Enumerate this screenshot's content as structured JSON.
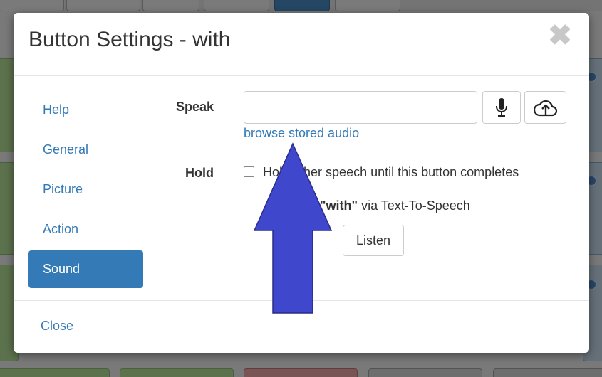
{
  "background": {
    "toolbar_tabs": [
      "",
      "",
      "",
      "",
      "",
      ""
    ]
  },
  "modal": {
    "title": "Button Settings - with",
    "close_glyph": "✖",
    "nav": [
      {
        "label": "Help",
        "active": false
      },
      {
        "label": "General",
        "active": false
      },
      {
        "label": "Picture",
        "active": false
      },
      {
        "label": "Action",
        "active": false
      },
      {
        "label": "Sound",
        "active": true
      }
    ],
    "speak": {
      "label": "Speak",
      "value": "",
      "placeholder": "",
      "record_icon": "microphone-icon",
      "upload_icon": "cloud-upload-icon",
      "browse_link": "browse stored audio"
    },
    "hold": {
      "label": "Hold",
      "checked": false,
      "text": "Hold other speech until this button completes"
    },
    "tts": {
      "bold_text": "\"with\"",
      "suffix": " via Text-To-Speech",
      "listen_label": "Listen"
    },
    "footer": {
      "close_label": "Close"
    }
  },
  "annotation": {
    "arrow_color": "#3f48cc"
  }
}
